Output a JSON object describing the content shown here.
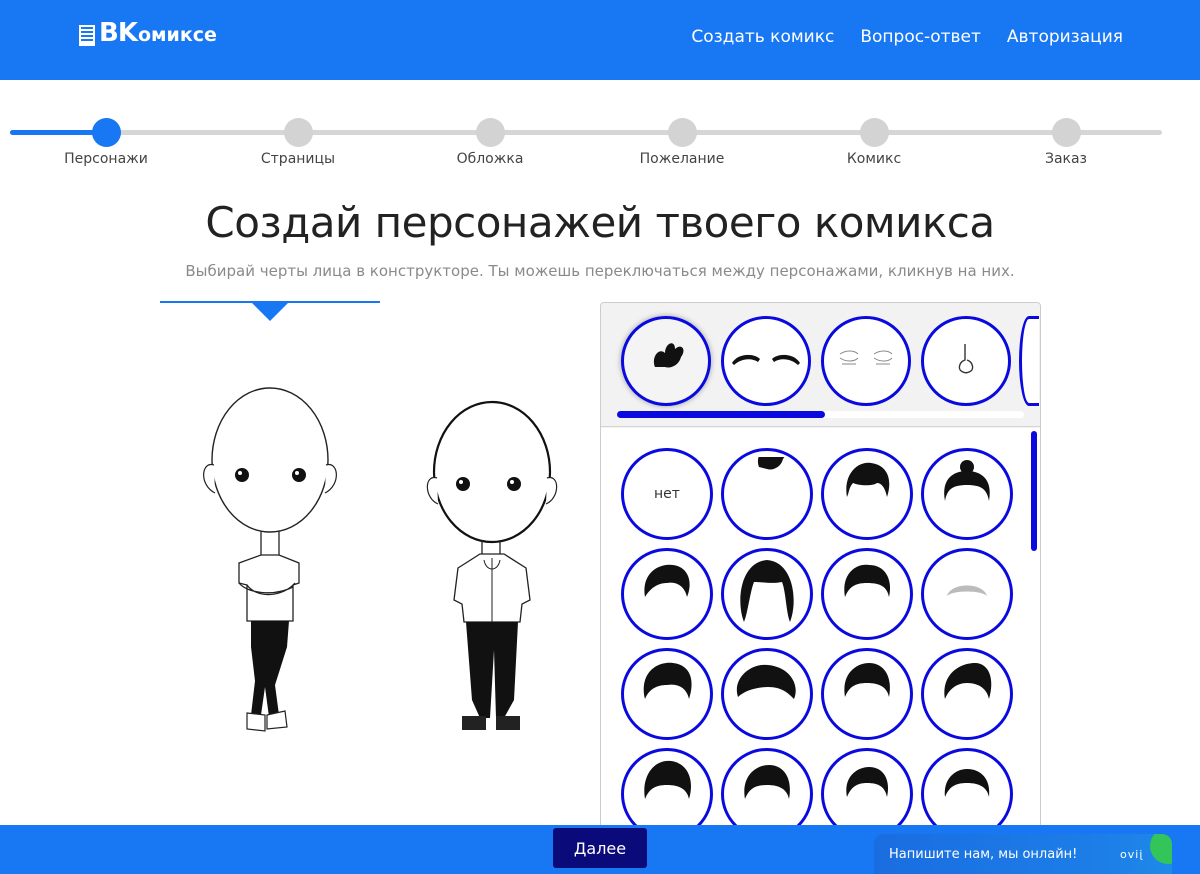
{
  "header": {
    "logo_bk": "BK",
    "logo_rest": "омиксе",
    "nav": [
      "Создать комикс",
      "Вопрос-ответ",
      "Авторизация"
    ]
  },
  "stepper": {
    "steps": [
      "Персонажи",
      "Страницы",
      "Обложка",
      "Пожелание",
      "Комикс",
      "Заказ"
    ],
    "active_index": 0
  },
  "main": {
    "title": "Создай персонажей твоего комикса",
    "subtitle": "Выбирай черты лица в конструкторе. Ты можешь переключаться между персонажами, кликнув на них."
  },
  "constructor": {
    "categories": [
      "hair-icon",
      "eyebrows-icon",
      "eyes-icon",
      "nose-icon"
    ],
    "active_category": 0,
    "options": {
      "none_label": "нет"
    }
  },
  "footer": {
    "next_label": "Далее"
  },
  "chat": {
    "text": "Напишите нам, мы онлайн!",
    "brand": "jivo"
  },
  "colors": {
    "brand_blue": "#1877f2",
    "option_ring": "#0a0adf",
    "next_button": "#0a0a7a"
  }
}
